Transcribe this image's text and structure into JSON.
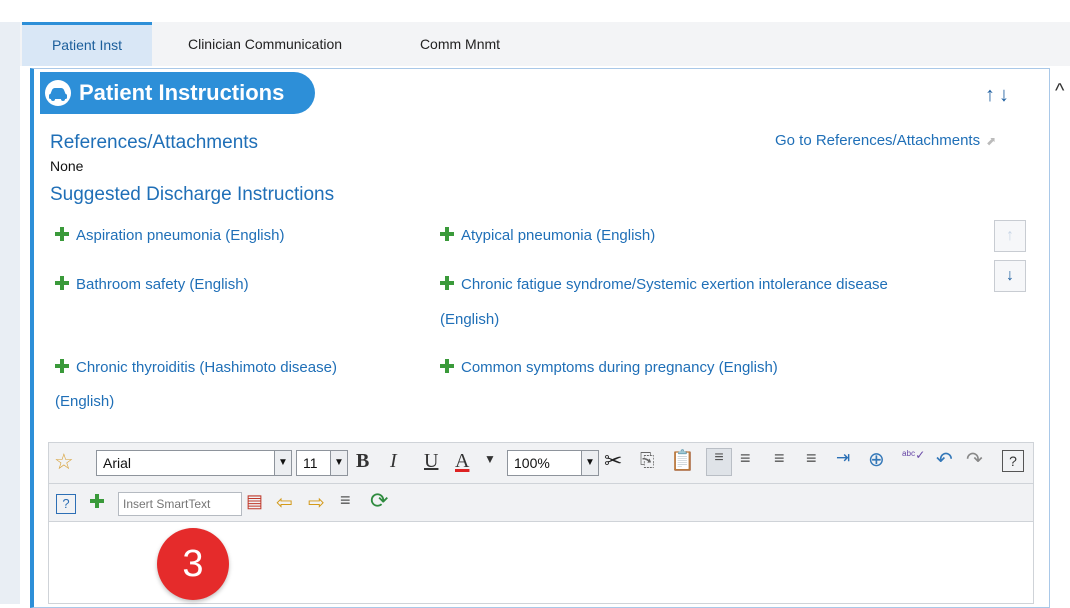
{
  "tabs": [
    {
      "label": "Patient Inst",
      "active": true
    },
    {
      "label": "Clinician Communication",
      "active": false
    },
    {
      "label": "Comm Mnmt",
      "active": false
    }
  ],
  "panel": {
    "title": "Patient Instructions",
    "header_icon": "car-icon"
  },
  "references": {
    "heading": "References/Attachments",
    "value": "None",
    "link": "Go to References/Attachments"
  },
  "suggested": {
    "heading": "Suggested Discharge Instructions",
    "items": [
      {
        "line1": "Aspiration pneumonia (English)",
        "line2": ""
      },
      {
        "line1": "Atypical pneumonia (English)",
        "line2": ""
      },
      {
        "line1": "Bathroom safety (English)",
        "line2": ""
      },
      {
        "line1": "Chronic fatigue syndrome/Systemic exertion intolerance disease",
        "line2": "(English)"
      },
      {
        "line1": "Chronic thyroiditis (Hashimoto disease)",
        "line2": "(English)"
      },
      {
        "line1": "Common symptoms during pregnancy (English)",
        "line2": ""
      }
    ]
  },
  "editor": {
    "font": "Arial",
    "size": "11",
    "zoom": "100%",
    "bold": "B",
    "italic": "I",
    "underline": "U",
    "font_color": "A",
    "smarttext_placeholder": "Insert SmartText"
  },
  "callout": "3",
  "colors": {
    "accent": "#2d8fd8",
    "link": "#1f6fb7",
    "plus": "#3a9a3a",
    "badge": "#e52b2b"
  }
}
